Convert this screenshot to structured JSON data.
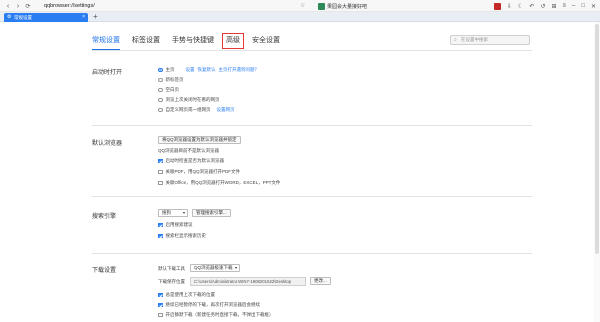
{
  "toolbar": {
    "url": "qqbrowser://settings/",
    "extension_text": "果园会大量接好吧"
  },
  "tabbar": {
    "tab_title": "常规设置",
    "new_tab": "+"
  },
  "nav": {
    "tabs": [
      "常规设置",
      "标签设置",
      "手势与快捷键",
      "高级",
      "安全设置"
    ],
    "search_placeholder": "在设置中搜索"
  },
  "startup": {
    "label": "启动时打开",
    "options": [
      "主页",
      "新标签页",
      "空白页",
      "浏览上次关闭时在看的网页",
      "自定义网页或一组网页"
    ],
    "home_links": [
      "设置",
      "恢复默认",
      "主页打开遇到问题？"
    ],
    "custom_link": "设置网页"
  },
  "default_browser": {
    "label": "默认浏览器",
    "button": "将QQ浏览器设置为默认浏览器并锁定",
    "status": "QQ浏览器目前不是默认浏览器",
    "checks": [
      "启动时检查是否为默认浏览器",
      "关联PDF，用QQ浏览器打开PDF文件",
      "关联Office，用QQ浏览器打开WORD，EXCEL，PPT文件"
    ]
  },
  "search_engine": {
    "label": "搜索引擎",
    "engine": "搜狗",
    "manage_button": "管理搜索引擎...",
    "checks": [
      "启用搜索建议",
      "搜索栏显示搜索历史"
    ]
  },
  "download": {
    "label": "下载设置",
    "tool_label": "默认下载工具",
    "tool_value": "QQ浏览器极速下载",
    "path_label": "下载保存位置",
    "path_value": "C:\\Users\\Administrator.WIN7-1908201522\\Desktop",
    "change_button": "更改...",
    "checks": [
      "总是使用上次下载的位置",
      "继续已经暂停的下载，再次打开浏览器后会继续",
      "开启静默下载（新建任务时直接下载，不弹出下载框）"
    ]
  }
}
